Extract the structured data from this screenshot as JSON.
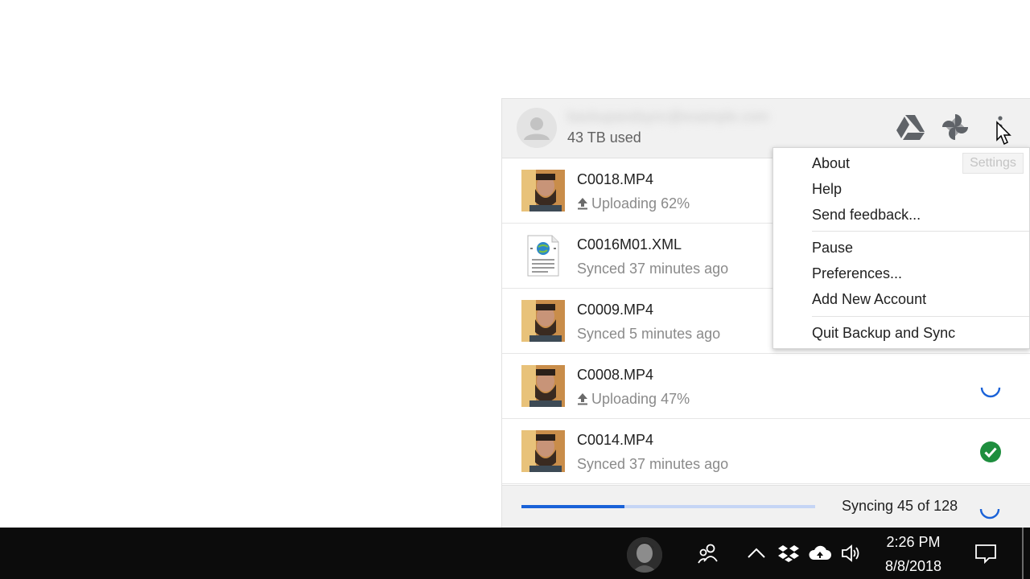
{
  "account": {
    "email": "backupandsync@example.com",
    "storage_used": "43 TB used"
  },
  "header_icons": [
    "google-drive-icon",
    "google-photos-icon",
    "more-vert-icon"
  ],
  "files": [
    {
      "name": "C0018.MP4",
      "status": "Uploading 62%",
      "state": "uploading",
      "thumb": "video-thumbnail"
    },
    {
      "name": "C0016M01.XML",
      "status": "Synced 37 minutes ago",
      "state": "synced",
      "thumb": "xml-file-icon"
    },
    {
      "name": "C0009.MP4",
      "status": "Synced 5 minutes ago",
      "state": "synced",
      "thumb": "video-thumbnail"
    },
    {
      "name": "C0008.MP4",
      "status": "Uploading 47%",
      "state": "uploading",
      "thumb": "video-thumbnail"
    },
    {
      "name": "C0014.MP4",
      "status": "Synced 37 minutes ago",
      "state": "synced",
      "thumb": "video-thumbnail"
    }
  ],
  "footer": {
    "sync_status": "Syncing 45 of 128",
    "progress_fraction": 0.35
  },
  "menu": {
    "items": [
      "About",
      "Help",
      "Send feedback...",
      "Pause",
      "Preferences...",
      "Add New Account",
      "Quit Backup and Sync"
    ]
  },
  "tooltip": "Settings",
  "taskbar": {
    "time": "2:26 PM",
    "date": "8/8/2018",
    "icons": [
      "people-icon",
      "chevron-up-icon",
      "dropbox-icon",
      "cloud-sync-icon",
      "volume-icon",
      "action-center-icon"
    ]
  },
  "colors": {
    "accent_blue": "#1a62d8",
    "synced_green": "#1e8e3e",
    "panel_gray": "#f1f1f1",
    "taskbar": "#0c0c0c"
  }
}
